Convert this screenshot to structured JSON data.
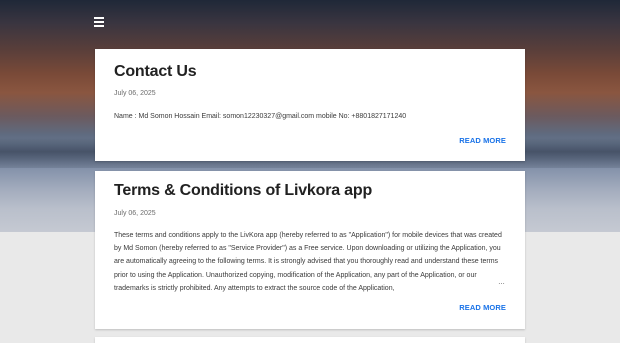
{
  "nav": {
    "menu_icon": "hamburger-menu-icon"
  },
  "posts": [
    {
      "title": "Contact Us",
      "date": "July 06, 2025",
      "snippet": "Name :  Md Somon Hossain Email: somon12230327@gmail.com mobile No: +8801827171240",
      "read_more": "READ MORE"
    },
    {
      "title": "Terms & Conditions of Livkora app",
      "date": "July 06, 2025",
      "snippet": "These terms and conditions apply to the LivKora app (hereby referred to as \"Application\") for mobile devices that was created by Md Somon (hereby referred to as \"Service Provider\") as a Free service. Upon downloading or utilizing the Application, you are automatically agreeing to the following terms. It is strongly advised that you thoroughly read and understand these terms prior to using the Application. Unauthorized copying, modification of the Application, any part of the Application, or our trademarks is strictly prohibited. Any attempts to extract the source code of the Application,",
      "ellipsis": "…",
      "read_more": "READ MORE"
    }
  ],
  "colors": {
    "link": "#1a73e8",
    "title": "#212121",
    "page_background": "#e9e9e9"
  }
}
